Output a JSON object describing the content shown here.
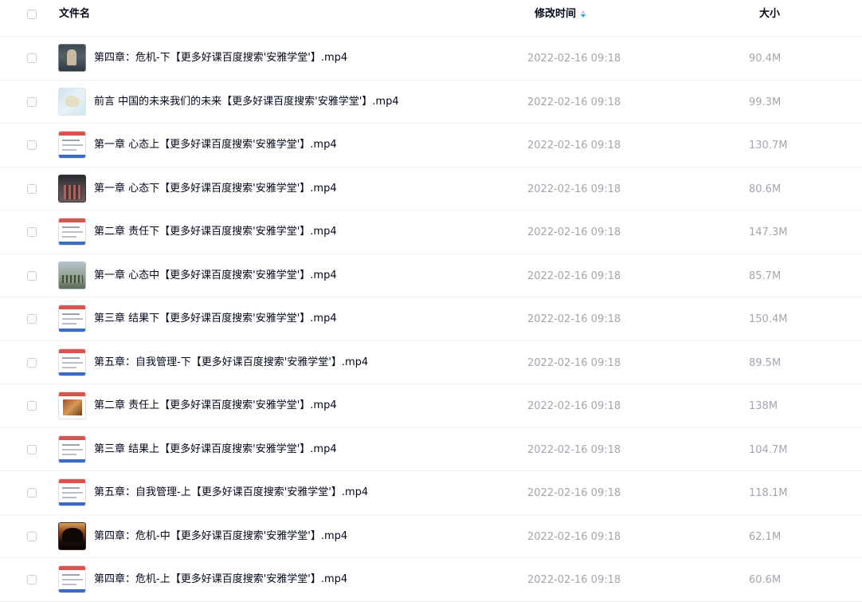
{
  "header": {
    "name_label": "文件名",
    "time_label": "修改时间",
    "size_label": "大小"
  },
  "files": [
    {
      "name": "第四章：危机-下【更多好课百度搜索'安雅学堂'】.mp4",
      "time": "2022-02-16 09:18",
      "size": "90.4M",
      "thumb": "dark-video"
    },
    {
      "name": "前言 中国的未来我们的未来【更多好课百度搜索'安雅学堂'】.mp4",
      "time": "2022-02-16 09:18",
      "size": "99.3M",
      "thumb": "map"
    },
    {
      "name": "第一章 心态上【更多好课百度搜索'安雅学堂'】.mp4",
      "time": "2022-02-16 09:18",
      "size": "130.7M",
      "thumb": "slide"
    },
    {
      "name": "第一章 心态下【更多好课百度搜索'安雅学堂'】.mp4",
      "time": "2022-02-16 09:18",
      "size": "80.6M",
      "thumb": "crowd"
    },
    {
      "name": "第二章 责任下【更多好课百度搜索'安雅学堂'】.mp4",
      "time": "2022-02-16 09:18",
      "size": "147.3M",
      "thumb": "slide"
    },
    {
      "name": "第一章 心态中【更多好课百度搜索'安雅学堂'】.mp4",
      "time": "2022-02-16 09:18",
      "size": "85.7M",
      "thumb": "outdoor"
    },
    {
      "name": "第三章 结果下【更多好课百度搜索'安雅学堂'】.mp4",
      "time": "2022-02-16 09:18",
      "size": "150.4M",
      "thumb": "slide"
    },
    {
      "name": "第五章：自我管理-下【更多好课百度搜索'安雅学堂'】.mp4",
      "time": "2022-02-16 09:18",
      "size": "89.5M",
      "thumb": "slide"
    },
    {
      "name": "第二章 责任上【更多好课百度搜索'安雅学堂'】.mp4",
      "time": "2022-02-16 09:18",
      "size": "138M",
      "thumb": "photo-slide"
    },
    {
      "name": "第三章 结果上【更多好课百度搜索'安雅学堂'】.mp4",
      "time": "2022-02-16 09:18",
      "size": "104.7M",
      "thumb": "slide"
    },
    {
      "name": "第五章：自我管理-上【更多好课百度搜索'安雅学堂'】.mp4",
      "time": "2022-02-16 09:18",
      "size": "118.1M",
      "thumb": "slide"
    },
    {
      "name": "第四章：危机-中【更多好课百度搜索'安雅学堂'】.mp4",
      "time": "2022-02-16 09:18",
      "size": "62.1M",
      "thumb": "sunset"
    },
    {
      "name": "第四章：危机-上【更多好课百度搜索'安雅学堂'】.mp4",
      "time": "2022-02-16 09:18",
      "size": "60.6M",
      "thumb": "slide"
    }
  ]
}
